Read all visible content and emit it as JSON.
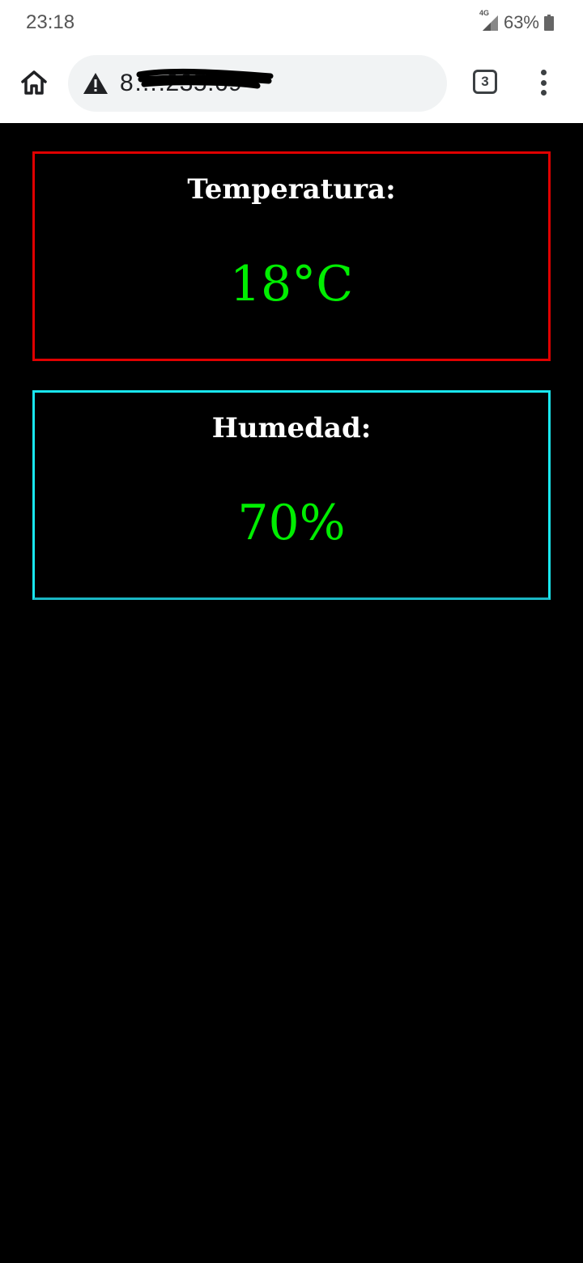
{
  "status_bar": {
    "time": "23:18",
    "network": "4G",
    "battery": "63%"
  },
  "browser": {
    "url_visible": "8….235.69",
    "tab_count": "3"
  },
  "icons": [
    "home-icon",
    "warning-icon",
    "tabs-icon",
    "overflow-menu-icon",
    "signal-icon",
    "battery-icon"
  ],
  "cards": [
    {
      "label": "Temperatura:",
      "value": "18°C",
      "border_color": "#e00000"
    },
    {
      "label": "Humedad:",
      "value": "70%",
      "border_color": "#19e6ee"
    }
  ],
  "colors": {
    "page_background": "#000000",
    "value_text": "#00ee00",
    "label_text": "#ffffff"
  }
}
